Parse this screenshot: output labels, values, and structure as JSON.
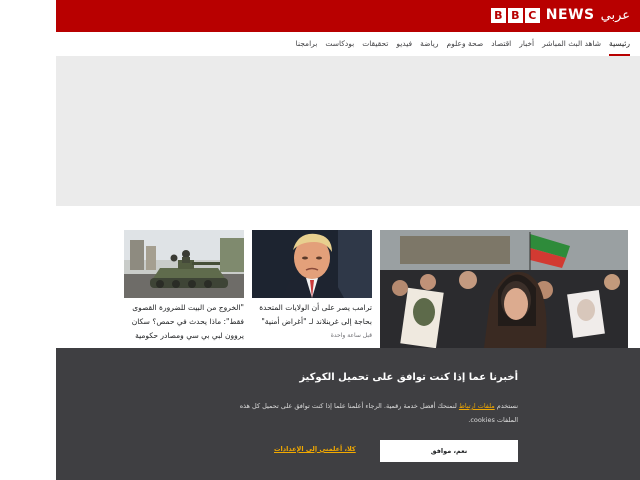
{
  "header": {
    "bbc_letters": [
      "B",
      "B",
      "C"
    ],
    "news_label": "NEWS",
    "arabic_label": "عربي",
    "background_color": "#b80000"
  },
  "nav": {
    "items": [
      {
        "label": "رئيسية",
        "active": true
      },
      {
        "label": "شاهد البث المباشر"
      },
      {
        "label": "أخبار"
      },
      {
        "label": "اقتصاد"
      },
      {
        "label": "صحة وعلوم"
      },
      {
        "label": "رياضة"
      },
      {
        "label": "فيديو"
      },
      {
        "label": "تحقيقات"
      },
      {
        "label": "بودكاست"
      },
      {
        "label": "برامجنا"
      }
    ]
  },
  "stories": [
    {
      "title": "",
      "time": ""
    },
    {
      "title": "ترامب يصر على أن الولايات المتحدة بحاجة إلى غرينلاند لـ \"أغراض أمنية\"",
      "time": "قبل ساعة واحدة"
    },
    {
      "title": "\"الخروج من البيت للضرورة القصوى فقط\": ماذا يحدث في حمص؟ سكان يروون لبي بي سي ومصادر حكومية ترد",
      "time": ""
    }
  ],
  "cookie_banner": {
    "title": "أخبرنا عما إذا كنت توافق على تحميل الكوكيز",
    "body_before_link": "نستخدم",
    "link_text": "ملفات ارتباط",
    "body_after_link": "لنمنحك أفضل خدمة رقمية. الرجاء أعلمنا علما إذا كنت توافق على تحميل كل هذه الملفات cookies.",
    "accept_label": "نعم، موافق",
    "settings_label": "كلا، أعلمني إلى الإعدادات",
    "link_color": "#f2a900",
    "background_color": "#3f3f42"
  }
}
